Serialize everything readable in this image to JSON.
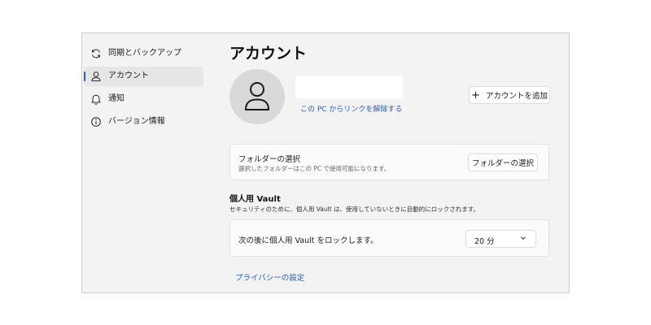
{
  "sidebar": {
    "items": [
      {
        "label": "同期とバックアップ",
        "icon": "sync-icon",
        "active": false
      },
      {
        "label": "アカウント",
        "icon": "person-icon",
        "active": true
      },
      {
        "label": "通知",
        "icon": "bell-icon",
        "active": false
      },
      {
        "label": "バージョン情報",
        "icon": "info-icon",
        "active": false
      }
    ]
  },
  "main": {
    "title": "アカウント",
    "unlink_link": "この PC からリンクを解除する",
    "add_account_button": "アカウントを追加",
    "folder_card": {
      "title": "フォルダーの選択",
      "description": "選択したフォルダーはこの PC で使用可能になります。",
      "button": "フォルダーの選択"
    },
    "vault": {
      "heading": "個人用 Vault",
      "description": "セキュリティのために、個人用 Vault は、使用していないときに自動的にロックされます。",
      "lock_label": "次の後に個人用 Vault をロックします。",
      "lock_value": "20 分"
    },
    "privacy_link": "プライバシーの設定"
  },
  "colors": {
    "accent": "#2b5fb4",
    "window_bg": "#f3f3f3",
    "card_bg": "#fbfbfb"
  }
}
